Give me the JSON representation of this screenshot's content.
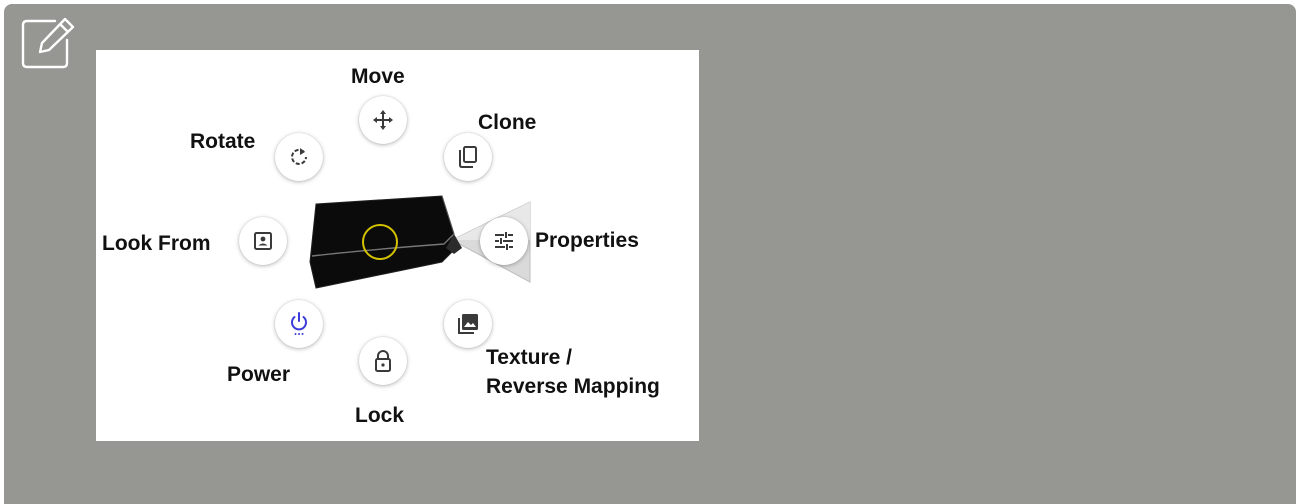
{
  "toolbar": {
    "edit_icon": "edit-icon"
  },
  "menu": {
    "move": "Move",
    "clone": "Clone",
    "rotate": "Rotate",
    "look_from": "Look From",
    "properties": "Properties",
    "power": "Power",
    "lock": "Lock",
    "texture_line1": "Texture /",
    "texture_line2": "Reverse Mapping"
  },
  "icons": {
    "move": "move-arrows-icon",
    "clone": "copy-icon",
    "rotate": "rotate-icon",
    "look_from": "portrait-icon",
    "properties": "sliders-icon",
    "power": "power-icon",
    "lock": "lock-icon",
    "texture": "image-stack-icon"
  },
  "colors": {
    "panel": "#969792",
    "power_icon": "#3b3bd9",
    "focus_ring": "#d4c200"
  }
}
